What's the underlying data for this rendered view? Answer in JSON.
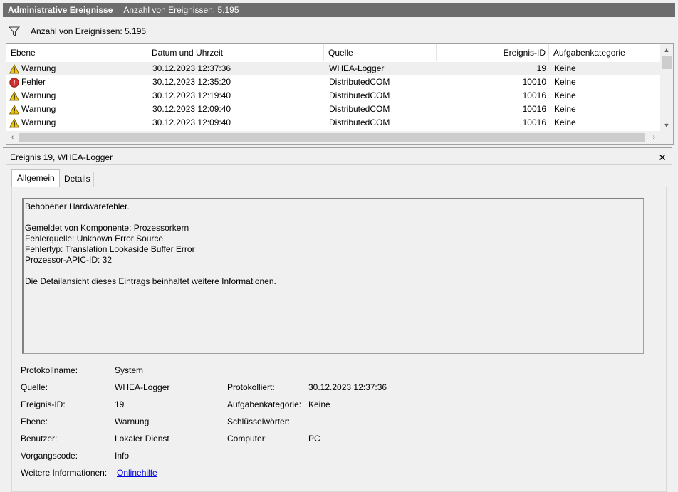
{
  "titlebar": {
    "title": "Administrative Ereignisse",
    "count": "Anzahl von Ereignissen: 5.195"
  },
  "filter": {
    "icon": "filter-funnel-icon",
    "text": "Anzahl von Ereignissen: 5.195"
  },
  "columns": [
    "Ebene",
    "Datum und Uhrzeit",
    "Quelle",
    "Ereignis-ID",
    "Aufgabenkategorie"
  ],
  "rows": [
    {
      "level": "Warnung",
      "icon": "warning-icon",
      "date": "30.12.2023 12:37:36",
      "source": "WHEA-Logger",
      "id": "19",
      "category": "Keine"
    },
    {
      "level": "Fehler",
      "icon": "error-icon",
      "date": "30.12.2023 12:35:20",
      "source": "DistributedCOM",
      "id": "10010",
      "category": "Keine"
    },
    {
      "level": "Warnung",
      "icon": "warning-icon",
      "date": "30.12.2023 12:19:40",
      "source": "DistributedCOM",
      "id": "10016",
      "category": "Keine"
    },
    {
      "level": "Warnung",
      "icon": "warning-icon",
      "date": "30.12.2023 12:09:40",
      "source": "DistributedCOM",
      "id": "10016",
      "category": "Keine"
    },
    {
      "level": "Warnung",
      "icon": "warning-icon",
      "date": "30.12.2023 12:09:40",
      "source": "DistributedCOM",
      "id": "10016",
      "category": "Keine"
    }
  ],
  "detail": {
    "header": "Ereignis 19, WHEA-Logger",
    "tabs": [
      "Allgemein",
      "Details"
    ],
    "message": [
      "Behobener Hardwarefehler.",
      "",
      "Gemeldet von Komponente: Prozessorkern",
      "Fehlerquelle: Unknown Error Source",
      "Fehlertyp: Translation Lookaside Buffer Error",
      "Prozessor-APIC-ID: 32",
      "",
      "Die Detailansicht dieses Eintrags beinhaltet weitere Informationen."
    ],
    "props": {
      "protokollname_label": "Protokollname:",
      "protokollname": "System",
      "quelle_label": "Quelle:",
      "quelle": "WHEA-Logger",
      "protokolliert_label": "Protokolliert:",
      "protokolliert": "30.12.2023 12:37:36",
      "ereignisid_label": "Ereignis-ID:",
      "ereignisid": "19",
      "aufgabe_label": "Aufgabenkategorie:",
      "aufgabe": "Keine",
      "ebene_label": "Ebene:",
      "ebene": "Warnung",
      "schluessel_label": "Schlüsselwörter:",
      "schluessel": "",
      "benutzer_label": "Benutzer:",
      "benutzer": "Lokaler Dienst",
      "computer_label": "Computer:",
      "computer": "PC",
      "vorgang_label": "Vorgangscode:",
      "vorgang": "Info",
      "weitere_label": "Weitere Informationen:",
      "weitere_link": "Onlinehilfe"
    }
  },
  "colors": {
    "title_bg": "#6d6d6d",
    "selected_row": "#efefef",
    "link": "#0000e0"
  }
}
